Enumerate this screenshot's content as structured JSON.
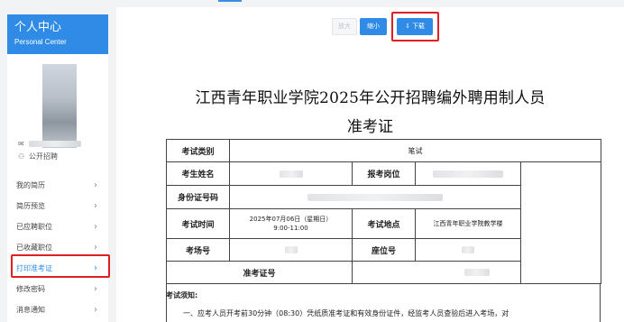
{
  "sidebar": {
    "title": "个人中心",
    "subtitle": "Personal Center",
    "user_type": "公开招聘",
    "items": [
      {
        "label": "我的简历"
      },
      {
        "label": "简历预览"
      },
      {
        "label": "已应聘职位"
      },
      {
        "label": "已收藏职位"
      },
      {
        "label": "打印准考证",
        "active": true
      },
      {
        "label": "修改密码"
      },
      {
        "label": "消息通知"
      }
    ]
  },
  "toolbar": {
    "zoom_in_label": "放大",
    "zoom_out_label": "缩小",
    "download_label": "下载",
    "download_icon": "cloud-download-icon"
  },
  "document": {
    "title_line1": "江西青年职业学院2025年公开招聘编外聘用制人员",
    "title_line2": "准考证",
    "fields": {
      "exam_type_label": "考试类别",
      "exam_type_value": "笔试",
      "name_label": "考生姓名",
      "position_label": "报考岗位",
      "id_label": "身份证号码",
      "exam_time_label": "考试时间",
      "exam_time_date": "2025年07月06日（星期日）",
      "exam_time_range": "9:00-11:00",
      "exam_place_label": "考试地点",
      "exam_place_value": "江西青年职业学院教学楼",
      "room_label": "考场号",
      "seat_label": "座位号",
      "ticket_no_label": "准考证号"
    },
    "notes_title": "考试须知:",
    "notes_line1": "一、应考人员开考前30分钟（08:30）凭纸质准考证和有效身份证件，经监考人员查验后进入考场，对"
  },
  "colors": {
    "accent": "#2f8be5",
    "highlight_box": "#e02020"
  }
}
